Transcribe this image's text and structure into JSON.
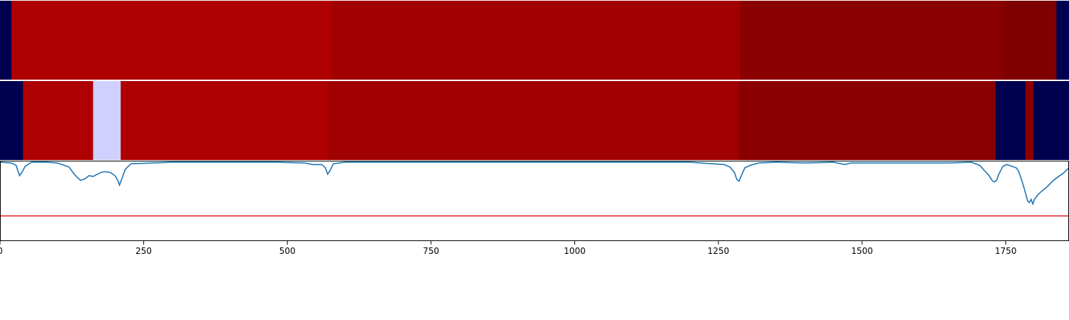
{
  "chart_data": [
    {
      "type": "heatmap",
      "xlim": [
        0,
        1860
      ],
      "colors": {
        "navy": "#000050",
        "red1": "#ae0000",
        "red2": "#a00000",
        "red3": "#8a0000",
        "red4": "#7e0000",
        "lavender": "#d0d0ff"
      },
      "segments": [
        {
          "start": 0,
          "end": 20,
          "color": "navy"
        },
        {
          "start": 20,
          "end": 578,
          "color": "red1"
        },
        {
          "start": 578,
          "end": 1288,
          "color": "red2"
        },
        {
          "start": 1288,
          "end": 1748,
          "color": "red3"
        },
        {
          "start": 1748,
          "end": 1838,
          "color": "red4"
        },
        {
          "start": 1838,
          "end": 1860,
          "color": "navy"
        }
      ]
    },
    {
      "type": "heatmap",
      "xlim": [
        0,
        1860
      ],
      "colors": {
        "navy": "#000050",
        "red1": "#ae0000",
        "red2": "#a00000",
        "red3": "#8a0000",
        "lavender": "#d0d0ff"
      },
      "segments": [
        {
          "start": 0,
          "end": 40,
          "color": "navy"
        },
        {
          "start": 40,
          "end": 162,
          "color": "red1"
        },
        {
          "start": 162,
          "end": 210,
          "color": "lavender"
        },
        {
          "start": 210,
          "end": 570,
          "color": "red1"
        },
        {
          "start": 570,
          "end": 1285,
          "color": "red2"
        },
        {
          "start": 1285,
          "end": 1732,
          "color": "red3"
        },
        {
          "start": 1732,
          "end": 1784,
          "color": "navy"
        },
        {
          "start": 1784,
          "end": 1798,
          "color": "red3"
        },
        {
          "start": 1798,
          "end": 1860,
          "color": "navy"
        }
      ]
    },
    {
      "type": "line",
      "xlim": [
        0,
        1860
      ],
      "ylim": [
        0,
        1
      ],
      "line_color": "#1f77b4",
      "threshold": {
        "value": 0.31,
        "color": "#e41a1c"
      },
      "xticks": [
        "0",
        "250",
        "500",
        "750",
        "1000",
        "1250",
        "1500",
        "1750"
      ],
      "series": [
        {
          "x": [
            0,
            20,
            28,
            34,
            38,
            44,
            55,
            80,
            100,
            120,
            128,
            134,
            140,
            148,
            155,
            162,
            170,
            176,
            182,
            192,
            200,
            205,
            208,
            212,
            218,
            228,
            300,
            400,
            480,
            530,
            545,
            560,
            566,
            570,
            574,
            580,
            600,
            700,
            800,
            900,
            1000,
            1100,
            1200,
            1260,
            1270,
            1278,
            1282,
            1286,
            1290,
            1296,
            1305,
            1320,
            1350,
            1400,
            1450,
            1470,
            1480,
            1500,
            1550,
            1600,
            1650,
            1690,
            1705,
            1712,
            1720,
            1726,
            1730,
            1734,
            1738,
            1745,
            1752,
            1760,
            1768,
            1772,
            1776,
            1782,
            1785,
            1788,
            1791,
            1794,
            1797,
            1800,
            1806,
            1812,
            1822,
            1830,
            1840,
            1850,
            1860
          ],
          "y": [
            0.99,
            0.98,
            0.95,
            0.82,
            0.86,
            0.94,
            0.99,
            0.99,
            0.98,
            0.93,
            0.85,
            0.8,
            0.76,
            0.78,
            0.82,
            0.81,
            0.84,
            0.86,
            0.87,
            0.86,
            0.82,
            0.76,
            0.7,
            0.78,
            0.9,
            0.97,
            0.99,
            0.99,
            0.99,
            0.98,
            0.96,
            0.96,
            0.92,
            0.84,
            0.88,
            0.97,
            0.99,
            0.99,
            0.99,
            0.99,
            0.99,
            0.99,
            0.99,
            0.96,
            0.93,
            0.86,
            0.77,
            0.75,
            0.82,
            0.92,
            0.95,
            0.98,
            0.99,
            0.98,
            0.99,
            0.96,
            0.98,
            0.98,
            0.98,
            0.98,
            0.98,
            0.99,
            0.95,
            0.89,
            0.83,
            0.76,
            0.74,
            0.76,
            0.84,
            0.94,
            0.96,
            0.94,
            0.92,
            0.88,
            0.8,
            0.66,
            0.58,
            0.5,
            0.48,
            0.52,
            0.46,
            0.52,
            0.58,
            0.62,
            0.68,
            0.74,
            0.8,
            0.85,
            0.92
          ]
        }
      ]
    }
  ]
}
